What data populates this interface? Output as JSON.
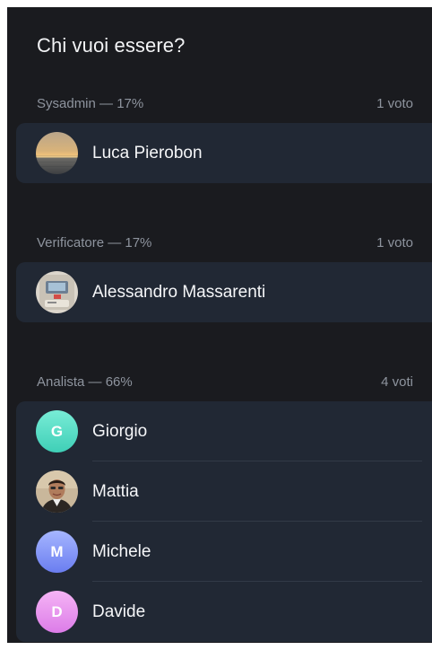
{
  "poll": {
    "title": "Chi vuoi essere?"
  },
  "options": [
    {
      "label": "Sysadmin — 17%",
      "votes": "1 voto",
      "voters": [
        {
          "name": "Luca Pierobon",
          "avatar": "sunset-photo"
        }
      ]
    },
    {
      "label": "Verificatore — 17%",
      "votes": "1 voto",
      "voters": [
        {
          "name": "Alessandro Massarenti",
          "avatar": "retro-camera-photo"
        }
      ]
    },
    {
      "label": "Analista — 66%",
      "votes": "4 voti",
      "voters": [
        {
          "name": "Giorgio",
          "avatar": "letter-avatar",
          "initial": "G",
          "color": "#5fe0c8"
        },
        {
          "name": "Mattia",
          "avatar": "portrait-photo"
        },
        {
          "name": "Michele",
          "avatar": "letter-avatar",
          "initial": "M",
          "color": "#8596f8"
        },
        {
          "name": "Davide",
          "avatar": "letter-avatar",
          "initial": "D",
          "color": "#e897ef"
        }
      ]
    }
  ]
}
